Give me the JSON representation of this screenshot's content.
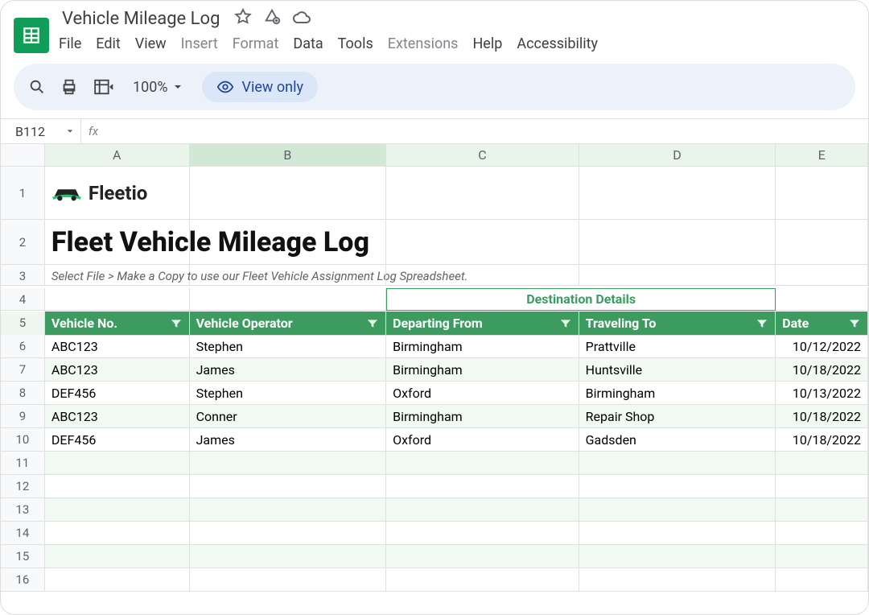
{
  "doc": {
    "title": "Vehicle Mileage Log"
  },
  "menu": {
    "file": "File",
    "edit": "Edit",
    "view": "View",
    "insert": "Insert",
    "format": "Format",
    "data": "Data",
    "tools": "Tools",
    "extensions": "Extensions",
    "help": "Help",
    "accessibility": "Accessibility"
  },
  "toolbar": {
    "zoom": "100%",
    "view_only": "View only"
  },
  "namebox": {
    "ref": "B112",
    "fx": "fx"
  },
  "columns": {
    "A": "A",
    "B": "B",
    "C": "C",
    "D": "D",
    "E": "E"
  },
  "sheet": {
    "brand": "Fleetio",
    "title": "Fleet Vehicle Mileage Log",
    "instruction": "Select File > Make a Copy to use our Fleet Vehicle Assignment Log Spreadsheet.",
    "dest_header": "Destination Details",
    "headers": {
      "vehicle_no": "Vehicle No.",
      "operator": "Vehicle Operator",
      "departing": "Departing From",
      "traveling": "Traveling To",
      "date": "Date"
    },
    "rows": [
      {
        "vehicle_no": "ABC123",
        "operator": "Stephen",
        "departing": "Birmingham",
        "traveling": "Prattville",
        "date": "10/12/2022"
      },
      {
        "vehicle_no": "ABC123",
        "operator": "James",
        "departing": "Birmingham",
        "traveling": "Huntsville",
        "date": "10/18/2022"
      },
      {
        "vehicle_no": "DEF456",
        "operator": "Stephen",
        "departing": "Oxford",
        "traveling": "Birmingham",
        "date": "10/13/2022"
      },
      {
        "vehicle_no": "ABC123",
        "operator": "Conner",
        "departing": "Birmingham",
        "traveling": "Repair Shop",
        "date": "10/18/2022"
      },
      {
        "vehicle_no": "DEF456",
        "operator": "James",
        "departing": "Oxford",
        "traveling": "Gadsden",
        "date": "10/18/2022"
      }
    ],
    "row_numbers": [
      "1",
      "2",
      "3",
      "4",
      "5",
      "6",
      "7",
      "8",
      "9",
      "10",
      "11",
      "12",
      "13",
      "14",
      "15",
      "16"
    ]
  }
}
